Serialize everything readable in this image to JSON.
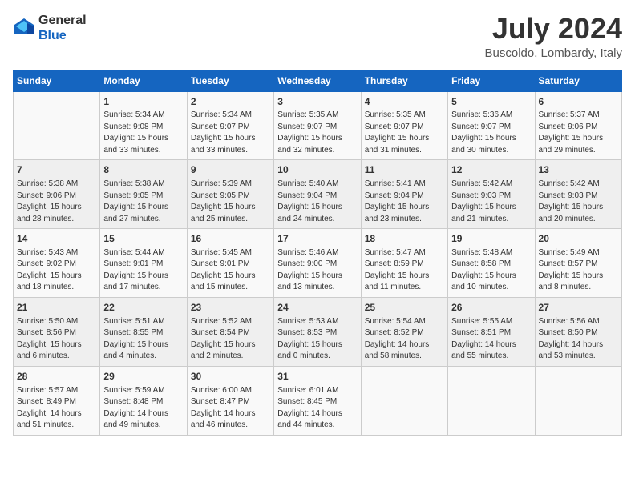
{
  "header": {
    "logo": {
      "line1": "General",
      "line2": "Blue"
    },
    "month": "July 2024",
    "location": "Buscoldo, Lombardy, Italy"
  },
  "days_of_week": [
    "Sunday",
    "Monday",
    "Tuesday",
    "Wednesday",
    "Thursday",
    "Friday",
    "Saturday"
  ],
  "weeks": [
    [
      {
        "day": "",
        "content": ""
      },
      {
        "day": "1",
        "content": "Sunrise: 5:34 AM\nSunset: 9:08 PM\nDaylight: 15 hours\nand 33 minutes."
      },
      {
        "day": "2",
        "content": "Sunrise: 5:34 AM\nSunset: 9:07 PM\nDaylight: 15 hours\nand 33 minutes."
      },
      {
        "day": "3",
        "content": "Sunrise: 5:35 AM\nSunset: 9:07 PM\nDaylight: 15 hours\nand 32 minutes."
      },
      {
        "day": "4",
        "content": "Sunrise: 5:35 AM\nSunset: 9:07 PM\nDaylight: 15 hours\nand 31 minutes."
      },
      {
        "day": "5",
        "content": "Sunrise: 5:36 AM\nSunset: 9:07 PM\nDaylight: 15 hours\nand 30 minutes."
      },
      {
        "day": "6",
        "content": "Sunrise: 5:37 AM\nSunset: 9:06 PM\nDaylight: 15 hours\nand 29 minutes."
      }
    ],
    [
      {
        "day": "7",
        "content": "Sunrise: 5:38 AM\nSunset: 9:06 PM\nDaylight: 15 hours\nand 28 minutes."
      },
      {
        "day": "8",
        "content": "Sunrise: 5:38 AM\nSunset: 9:05 PM\nDaylight: 15 hours\nand 27 minutes."
      },
      {
        "day": "9",
        "content": "Sunrise: 5:39 AM\nSunset: 9:05 PM\nDaylight: 15 hours\nand 25 minutes."
      },
      {
        "day": "10",
        "content": "Sunrise: 5:40 AM\nSunset: 9:04 PM\nDaylight: 15 hours\nand 24 minutes."
      },
      {
        "day": "11",
        "content": "Sunrise: 5:41 AM\nSunset: 9:04 PM\nDaylight: 15 hours\nand 23 minutes."
      },
      {
        "day": "12",
        "content": "Sunrise: 5:42 AM\nSunset: 9:03 PM\nDaylight: 15 hours\nand 21 minutes."
      },
      {
        "day": "13",
        "content": "Sunrise: 5:42 AM\nSunset: 9:03 PM\nDaylight: 15 hours\nand 20 minutes."
      }
    ],
    [
      {
        "day": "14",
        "content": "Sunrise: 5:43 AM\nSunset: 9:02 PM\nDaylight: 15 hours\nand 18 minutes."
      },
      {
        "day": "15",
        "content": "Sunrise: 5:44 AM\nSunset: 9:01 PM\nDaylight: 15 hours\nand 17 minutes."
      },
      {
        "day": "16",
        "content": "Sunrise: 5:45 AM\nSunset: 9:01 PM\nDaylight: 15 hours\nand 15 minutes."
      },
      {
        "day": "17",
        "content": "Sunrise: 5:46 AM\nSunset: 9:00 PM\nDaylight: 15 hours\nand 13 minutes."
      },
      {
        "day": "18",
        "content": "Sunrise: 5:47 AM\nSunset: 8:59 PM\nDaylight: 15 hours\nand 11 minutes."
      },
      {
        "day": "19",
        "content": "Sunrise: 5:48 AM\nSunset: 8:58 PM\nDaylight: 15 hours\nand 10 minutes."
      },
      {
        "day": "20",
        "content": "Sunrise: 5:49 AM\nSunset: 8:57 PM\nDaylight: 15 hours\nand 8 minutes."
      }
    ],
    [
      {
        "day": "21",
        "content": "Sunrise: 5:50 AM\nSunset: 8:56 PM\nDaylight: 15 hours\nand 6 minutes."
      },
      {
        "day": "22",
        "content": "Sunrise: 5:51 AM\nSunset: 8:55 PM\nDaylight: 15 hours\nand 4 minutes."
      },
      {
        "day": "23",
        "content": "Sunrise: 5:52 AM\nSunset: 8:54 PM\nDaylight: 15 hours\nand 2 minutes."
      },
      {
        "day": "24",
        "content": "Sunrise: 5:53 AM\nSunset: 8:53 PM\nDaylight: 15 hours\nand 0 minutes."
      },
      {
        "day": "25",
        "content": "Sunrise: 5:54 AM\nSunset: 8:52 PM\nDaylight: 14 hours\nand 58 minutes."
      },
      {
        "day": "26",
        "content": "Sunrise: 5:55 AM\nSunset: 8:51 PM\nDaylight: 14 hours\nand 55 minutes."
      },
      {
        "day": "27",
        "content": "Sunrise: 5:56 AM\nSunset: 8:50 PM\nDaylight: 14 hours\nand 53 minutes."
      }
    ],
    [
      {
        "day": "28",
        "content": "Sunrise: 5:57 AM\nSunset: 8:49 PM\nDaylight: 14 hours\nand 51 minutes."
      },
      {
        "day": "29",
        "content": "Sunrise: 5:59 AM\nSunset: 8:48 PM\nDaylight: 14 hours\nand 49 minutes."
      },
      {
        "day": "30",
        "content": "Sunrise: 6:00 AM\nSunset: 8:47 PM\nDaylight: 14 hours\nand 46 minutes."
      },
      {
        "day": "31",
        "content": "Sunrise: 6:01 AM\nSunset: 8:45 PM\nDaylight: 14 hours\nand 44 minutes."
      },
      {
        "day": "",
        "content": ""
      },
      {
        "day": "",
        "content": ""
      },
      {
        "day": "",
        "content": ""
      }
    ]
  ]
}
